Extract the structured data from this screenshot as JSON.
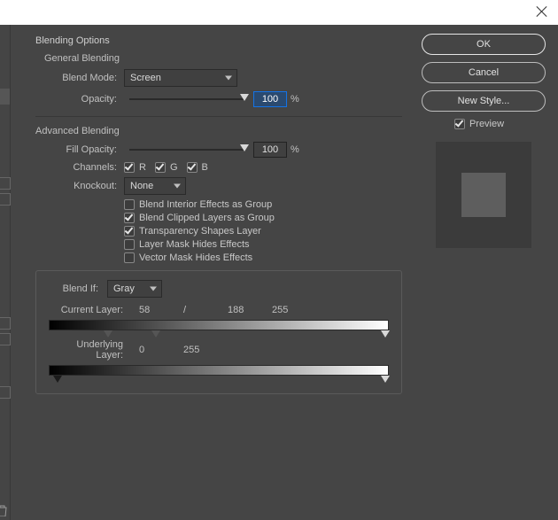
{
  "titlebar": {
    "close": "×"
  },
  "buttons": {
    "ok": "OK",
    "cancel": "Cancel",
    "newstyle": "New Style...",
    "preview": "Preview"
  },
  "sections": {
    "blendingOptions": "Blending Options",
    "generalBlending": "General Blending",
    "advancedBlending": "Advanced Blending"
  },
  "general": {
    "blendModeLabel": "Blend Mode:",
    "blendModeValue": "Screen",
    "opacityLabel": "Opacity:",
    "opacityValue": "100",
    "pct": "%"
  },
  "advanced": {
    "fillOpacityLabel": "Fill Opacity:",
    "fillOpacityValue": "100",
    "channelsLabel": "Channels:",
    "channelR": "R",
    "channelG": "G",
    "channelB": "B",
    "knockoutLabel": "Knockout:",
    "knockoutValue": "None",
    "cb1": "Blend Interior Effects as Group",
    "cb2": "Blend Clipped Layers as Group",
    "cb3": "Transparency Shapes Layer",
    "cb4": "Layer Mask Hides Effects",
    "cb5": "Vector Mask Hides Effects"
  },
  "blendIf": {
    "label": "Blend If:",
    "value": "Gray",
    "currentLayerLabel": "Current Layer:",
    "currentVals": {
      "a": "58",
      "sep": "/",
      "b": "188",
      "c": "255"
    },
    "underlyingLabel": "Underlying Layer:",
    "underlyingVals": {
      "a": "0",
      "b": "255"
    }
  }
}
